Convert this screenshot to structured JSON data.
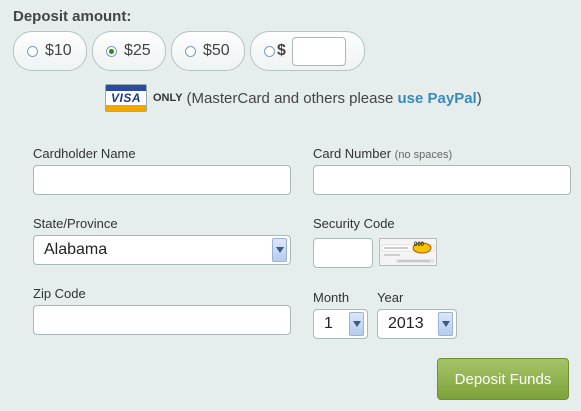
{
  "deposit": {
    "title": "Deposit amount:",
    "options": [
      {
        "label": "$10",
        "checked": false
      },
      {
        "label": "$25",
        "checked": true
      },
      {
        "label": "$50",
        "checked": false
      }
    ],
    "custom_prefix": "$",
    "custom_value": ""
  },
  "cards": {
    "visa_text": "VISA",
    "only_text": "ONLY",
    "note_text": "(MasterCard and others please",
    "paypal_link": "use PayPal",
    "close_paren": ")"
  },
  "form": {
    "cardholder_label": "Cardholder Name",
    "cardholder_value": "",
    "card_number_label": "Card Number",
    "card_number_hint": "(no spaces)",
    "card_number_value": "",
    "state_label": "State/Province",
    "state_value": "Alabama",
    "security_label": "Security Code",
    "security_value": "",
    "cvv_sample": "000",
    "zip_label": "Zip Code",
    "zip_value": "",
    "month_label": "Month",
    "month_value": "1",
    "year_label": "Year",
    "year_value": "2013"
  },
  "submit_label": "Deposit Funds",
  "colors": {
    "background": "#e6eded",
    "link": "#3a8ab8",
    "button": "#8aad47"
  }
}
